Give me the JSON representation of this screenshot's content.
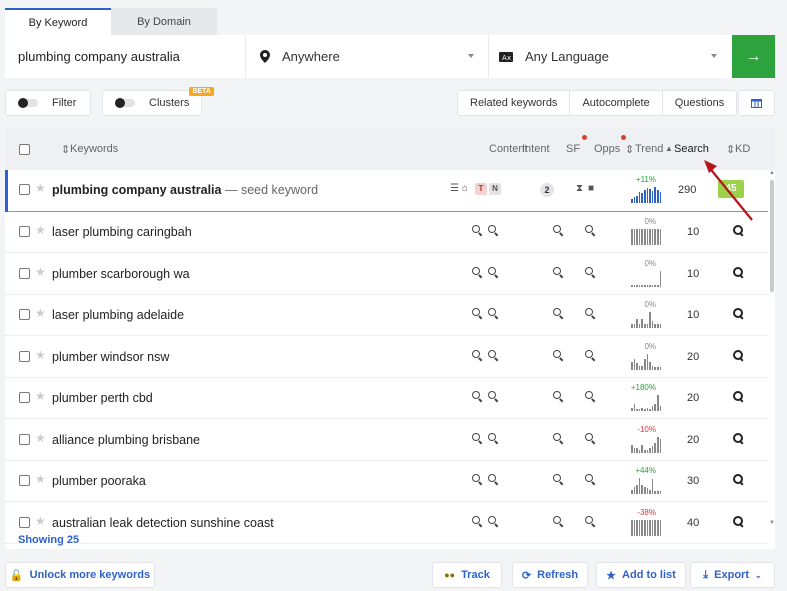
{
  "tabs": [
    {
      "label": "By Keyword",
      "active": true
    },
    {
      "label": "By Domain",
      "active": false
    }
  ],
  "search": {
    "keyword_value": "plumbing company australia",
    "location": "Anywhere",
    "language": "Any Language",
    "go_icon": "arrow-right-icon"
  },
  "filters": {
    "filter_label": "Filter",
    "clusters_label": "Clusters",
    "beta_badge": "BETA",
    "segments": [
      "Related keywords",
      "Autocomplete",
      "Questions"
    ]
  },
  "table": {
    "headers": {
      "keywords": "Keywords",
      "content": "Content",
      "intent": "Intent",
      "sf": "SF",
      "opps": "Opps",
      "trend": "Trend",
      "search": "Search",
      "kd": "KD"
    },
    "seed": {
      "keyword": "plumbing company australia",
      "note": "— seed keyword",
      "intent_t": "T",
      "intent_n": "N",
      "sf_count": "2",
      "trend_pct": "+11%",
      "trend_bars": [
        4,
        6,
        7,
        10,
        9,
        12,
        14,
        13,
        11,
        15,
        12,
        10
      ],
      "search": "290",
      "kd": "45"
    },
    "rows": [
      {
        "keyword": "laser plumbing caringbah",
        "trend_pct": "0%",
        "trend_dir": "flat",
        "trend_bars": [
          14,
          14,
          14,
          14,
          14,
          14,
          14,
          14,
          14,
          14,
          14,
          14
        ],
        "search": "10"
      },
      {
        "keyword": "plumber scarborough wa",
        "trend_pct": "0%",
        "trend_dir": "flat",
        "trend_bars": [
          2,
          2,
          2,
          2,
          2,
          2,
          2,
          2,
          2,
          2,
          2,
          14
        ],
        "search": "10"
      },
      {
        "keyword": "laser plumbing adelaide",
        "trend_pct": "0%",
        "trend_dir": "flat",
        "trend_bars": [
          3,
          3,
          7,
          3,
          7,
          3,
          3,
          12,
          5,
          3,
          3,
          3
        ],
        "search": "10"
      },
      {
        "keyword": "plumber windsor nsw",
        "trend_pct": "0%",
        "trend_dir": "flat",
        "trend_bars": [
          6,
          8,
          5,
          3,
          3,
          8,
          12,
          6,
          3,
          2,
          2,
          2
        ],
        "search": "20"
      },
      {
        "keyword": "plumber perth cbd",
        "trend_pct": "+180%",
        "trend_dir": "up",
        "trend_bars": [
          3,
          6,
          2,
          2,
          3,
          2,
          3,
          2,
          4,
          6,
          14,
          4
        ],
        "search": "20"
      },
      {
        "keyword": "alliance plumbing brisbane",
        "trend_pct": "-10%",
        "trend_dir": "down",
        "trend_bars": [
          7,
          4,
          4,
          3,
          7,
          3,
          3,
          4,
          6,
          9,
          14,
          12
        ],
        "search": "20"
      },
      {
        "keyword": "plumber pooraka",
        "trend_pct": "+44%",
        "trend_dir": "up",
        "trend_bars": [
          3,
          5,
          6,
          11,
          6,
          5,
          4,
          3,
          10,
          2,
          2,
          2
        ],
        "search": "30"
      },
      {
        "keyword": "australian leak detection sunshine coast",
        "trend_pct": "-38%",
        "trend_dir": "down",
        "trend_bars": [
          6,
          6,
          6,
          6,
          6,
          6,
          6,
          6,
          6,
          6,
          6,
          6
        ],
        "search": "40"
      }
    ],
    "showing": "Showing 25"
  },
  "bottom": {
    "unlock": "Unlock more keywords",
    "track": "Track",
    "refresh": "Refresh",
    "add_to_list": "Add to list",
    "export": "Export"
  },
  "colors": {
    "accent": "#2f62c9",
    "go_button": "#2ca33c",
    "kd_badge": "#9ad24a",
    "annotation_arrow": "#b3151b"
  }
}
